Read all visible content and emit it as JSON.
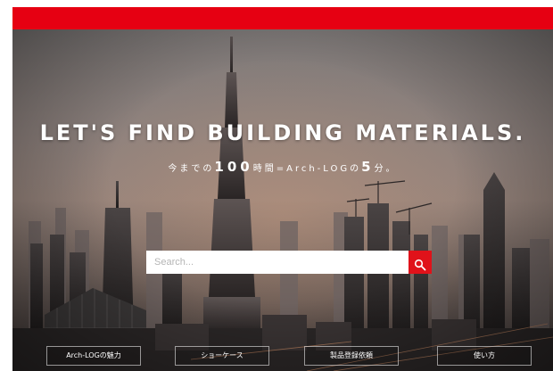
{
  "hero": {
    "headline": "LET'S FIND BUILDING MATERIALS.",
    "subline_pre": "今までの",
    "subline_num1": "100",
    "subline_mid": "時間=Arch-LOGの",
    "subline_num2": "5",
    "subline_post": "分。"
  },
  "search": {
    "placeholder": "Search..."
  },
  "nav": {
    "items": [
      {
        "label": "Arch-LOGの魅力"
      },
      {
        "label": "ショーケース"
      },
      {
        "label": "製品登録依頼"
      },
      {
        "label": "使い方"
      }
    ]
  },
  "colors": {
    "brand_red": "#e60012",
    "search_button": "#e0121a"
  },
  "icons": {
    "search": "search-icon"
  }
}
